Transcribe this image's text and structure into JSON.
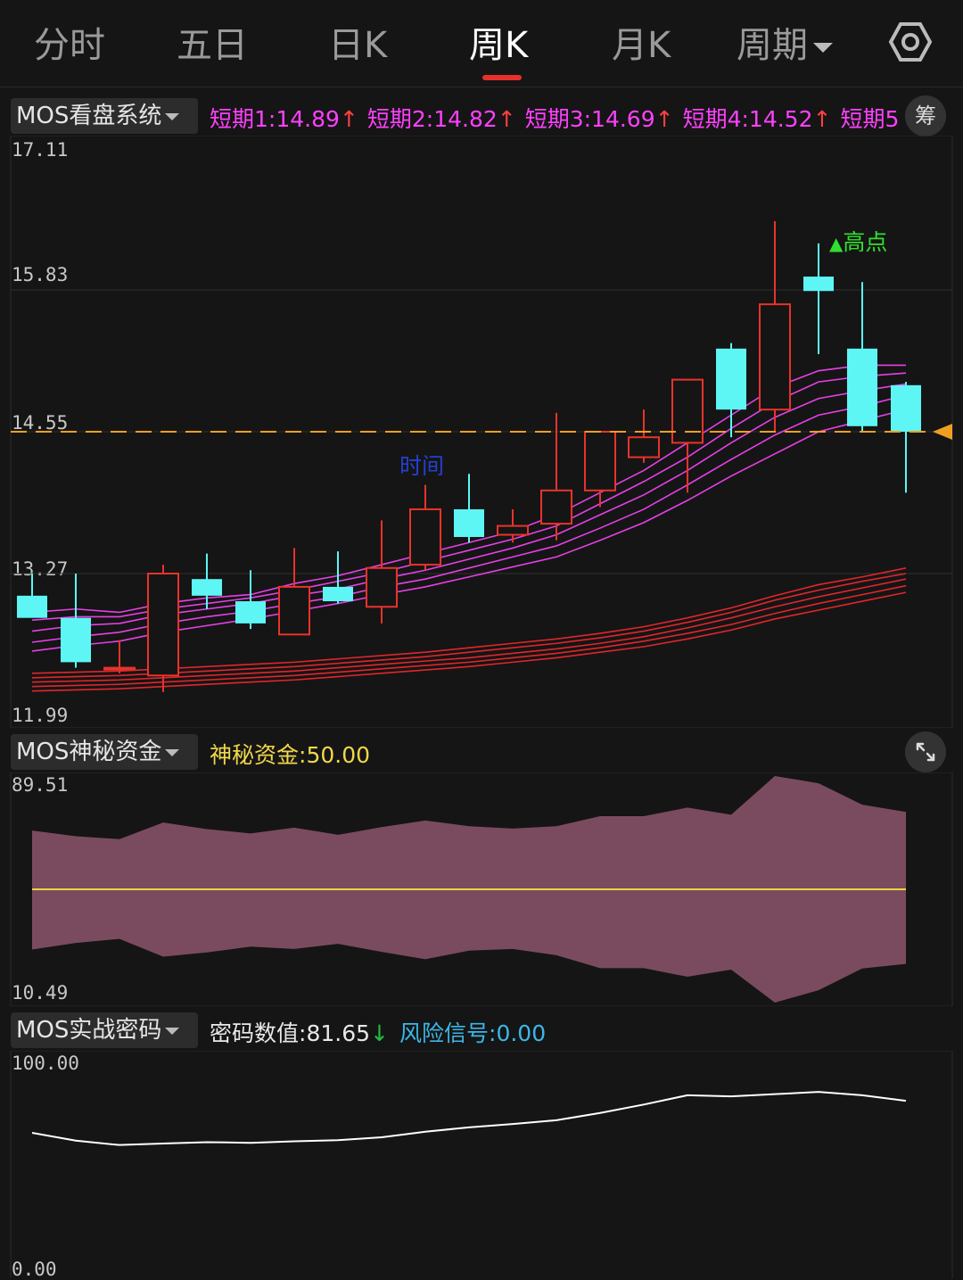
{
  "tabs": [
    {
      "label": "分时"
    },
    {
      "label": "五日"
    },
    {
      "label": "日K"
    },
    {
      "label": "周K",
      "active": true
    },
    {
      "label": "月K"
    },
    {
      "label": "周期"
    }
  ],
  "icons": {
    "settings": "gear-hexagon-icon",
    "expand": "expand-arrows-icon",
    "chips": "筹"
  },
  "main_panel": {
    "selector": "MOS看盘系统",
    "legend": [
      {
        "name": "短期1",
        "value": "14.89",
        "arrow": "↑"
      },
      {
        "name": "短期2",
        "value": "14.82",
        "arrow": "↑"
      },
      {
        "name": "短期3",
        "value": "14.69",
        "arrow": "↑"
      },
      {
        "name": "短期4",
        "value": "14.52",
        "arrow": "↑"
      },
      {
        "name": "短期5",
        "value": "",
        "arrow": ""
      }
    ],
    "y_labels": [
      "17.11",
      "15.83",
      "14.55",
      "13.27",
      "11.99"
    ],
    "annotation_time": "时间",
    "annotation_high": "高点",
    "high_marker": "▲"
  },
  "mid_panel": {
    "selector": "MOS神秘资金",
    "legend_name": "神秘资金",
    "legend_value": "50.00",
    "y_labels": [
      "89.51",
      "10.49"
    ]
  },
  "bottom_panel": {
    "selector": "MOS实战密码",
    "legend1_name": "密码数值",
    "legend1_value": "81.65",
    "legend1_arrow": "↓",
    "legend2_name": "风险信号",
    "legend2_value": "0.00",
    "y_labels": [
      "100.00",
      "0.00"
    ]
  },
  "colors": {
    "up": "#e8332b",
    "down": "#5ef5f5",
    "ma_short": "#e640e6",
    "ma_long": "#e0262b",
    "price_line": "#f0a020",
    "band": "#7a4b5e",
    "mid_line": "#e8d63a",
    "code_line": "#ffffff",
    "legend_magenta": "#ff40ff",
    "legend_yellow": "#f0d84a",
    "legend_cyan": "#3ab8e8",
    "arrow_up": "#ff4040",
    "arrow_down": "#20c040",
    "high_green": "#30e030"
  },
  "chart_data": [
    {
      "type": "candlestick",
      "ylim": [
        11.99,
        17.11
      ],
      "current_price": 14.55,
      "candles": [
        {
          "o": 13.07,
          "h": 13.27,
          "l": 12.95,
          "c": 12.87,
          "dir": "down"
        },
        {
          "o": 12.87,
          "h": 13.27,
          "l": 12.42,
          "c": 12.47,
          "dir": "down"
        },
        {
          "o": 12.42,
          "h": 12.67,
          "l": 12.37,
          "c": 12.42,
          "dir": "up"
        },
        {
          "o": 12.35,
          "h": 13.35,
          "l": 12.2,
          "c": 13.27,
          "dir": "up"
        },
        {
          "o": 13.22,
          "h": 13.45,
          "l": 12.95,
          "c": 13.07,
          "dir": "down"
        },
        {
          "o": 13.02,
          "h": 13.3,
          "l": 12.77,
          "c": 12.82,
          "dir": "down"
        },
        {
          "o": 12.72,
          "h": 13.5,
          "l": 12.72,
          "c": 13.15,
          "dir": "up"
        },
        {
          "o": 13.15,
          "h": 13.47,
          "l": 13.0,
          "c": 13.02,
          "dir": "down"
        },
        {
          "o": 12.97,
          "h": 13.75,
          "l": 12.82,
          "c": 13.32,
          "dir": "up"
        },
        {
          "o": 13.35,
          "h": 14.07,
          "l": 13.3,
          "c": 13.85,
          "dir": "up"
        },
        {
          "o": 13.85,
          "h": 14.17,
          "l": 13.55,
          "c": 13.6,
          "dir": "down"
        },
        {
          "o": 13.62,
          "h": 13.85,
          "l": 13.55,
          "c": 13.7,
          "dir": "up"
        },
        {
          "o": 13.72,
          "h": 14.72,
          "l": 13.57,
          "c": 14.02,
          "dir": "up"
        },
        {
          "o": 14.02,
          "h": 14.45,
          "l": 13.87,
          "c": 14.55,
          "dir": "up"
        },
        {
          "o": 14.32,
          "h": 14.75,
          "l": 14.27,
          "c": 14.5,
          "dir": "up"
        },
        {
          "o": 14.45,
          "h": 14.9,
          "l": 14.0,
          "c": 15.02,
          "dir": "up"
        },
        {
          "o": 14.75,
          "h": 15.35,
          "l": 14.5,
          "c": 15.3,
          "dir": "down"
        },
        {
          "o": 14.75,
          "h": 16.45,
          "l": 14.55,
          "c": 15.7,
          "dir": "up"
        },
        {
          "o": 15.95,
          "h": 16.25,
          "l": 15.25,
          "c": 15.82,
          "dir": "down"
        },
        {
          "o": 15.3,
          "h": 15.9,
          "l": 14.55,
          "c": 14.6,
          "dir": "down"
        },
        {
          "o": 14.97,
          "h": 15.0,
          "l": 14.0,
          "c": 14.55,
          "dir": "down"
        }
      ],
      "ma_short": [
        [
          12.92,
          12.95,
          12.92,
          13.0,
          13.05,
          13.08,
          13.18,
          13.25,
          13.35,
          13.45,
          13.55,
          13.65,
          13.8,
          14.0,
          14.2,
          14.45,
          14.7,
          14.95,
          15.1,
          15.15,
          15.15
        ],
        [
          12.85,
          12.88,
          12.88,
          12.95,
          13.0,
          13.05,
          13.12,
          13.2,
          13.28,
          13.38,
          13.48,
          13.58,
          13.7,
          13.9,
          14.1,
          14.32,
          14.58,
          14.82,
          15.0,
          15.05,
          15.08
        ],
        [
          12.75,
          12.8,
          12.82,
          12.9,
          12.95,
          13.0,
          13.07,
          13.13,
          13.22,
          13.3,
          13.4,
          13.5,
          13.62,
          13.8,
          13.98,
          14.2,
          14.45,
          14.68,
          14.85,
          14.92,
          14.98
        ],
        [
          12.65,
          12.7,
          12.74,
          12.82,
          12.88,
          12.93,
          13.0,
          13.06,
          13.15,
          13.22,
          13.32,
          13.42,
          13.52,
          13.68,
          13.85,
          14.07,
          14.3,
          14.52,
          14.7,
          14.78,
          14.88
        ],
        [
          12.57,
          12.62,
          12.66,
          12.74,
          12.8,
          12.86,
          12.93,
          13.0,
          13.08,
          13.15,
          13.24,
          13.33,
          13.42,
          13.57,
          13.73,
          13.93,
          14.15,
          14.35,
          14.55,
          14.65,
          14.75
        ]
      ],
      "ma_long": [
        [
          12.37,
          12.38,
          12.39,
          12.41,
          12.43,
          12.45,
          12.47,
          12.5,
          12.53,
          12.56,
          12.6,
          12.64,
          12.68,
          12.73,
          12.79,
          12.87,
          12.96,
          13.07,
          13.17,
          13.24,
          13.32
        ],
        [
          12.33,
          12.34,
          12.35,
          12.37,
          12.39,
          12.41,
          12.43,
          12.46,
          12.49,
          12.52,
          12.56,
          12.6,
          12.64,
          12.69,
          12.75,
          12.83,
          12.92,
          13.03,
          13.12,
          13.2,
          13.27
        ],
        [
          12.29,
          12.3,
          12.31,
          12.33,
          12.35,
          12.37,
          12.39,
          12.42,
          12.45,
          12.48,
          12.51,
          12.55,
          12.59,
          12.64,
          12.7,
          12.78,
          12.87,
          12.97,
          13.06,
          13.14,
          13.22
        ],
        [
          12.25,
          12.26,
          12.27,
          12.29,
          12.31,
          12.33,
          12.35,
          12.38,
          12.41,
          12.44,
          12.47,
          12.51,
          12.55,
          12.6,
          12.66,
          12.73,
          12.81,
          12.91,
          13.0,
          13.08,
          13.16
        ],
        [
          12.21,
          12.22,
          12.23,
          12.25,
          12.27,
          12.29,
          12.31,
          12.34,
          12.37,
          12.4,
          12.43,
          12.47,
          12.51,
          12.56,
          12.61,
          12.68,
          12.76,
          12.86,
          12.94,
          13.02,
          13.1
        ]
      ]
    },
    {
      "type": "area",
      "ylim": [
        10.49,
        89.51
      ],
      "mid": 50.0,
      "upper": [
        70.5,
        68.5,
        67.5,
        73.3,
        71.0,
        69.5,
        71.5,
        69.0,
        71.7,
        74.0,
        72.0,
        71.2,
        72.0,
        75.5,
        75.5,
        78.5,
        76.0,
        89.5,
        87.0,
        79.5,
        77.0
      ],
      "lower": [
        29.0,
        31.3,
        32.7,
        26.5,
        28.0,
        30.0,
        29.2,
        31.0,
        28.2,
        25.6,
        28.6,
        29.2,
        27.0,
        22.5,
        22.5,
        19.5,
        22.0,
        10.5,
        14.8,
        22.4,
        24.0
      ]
    },
    {
      "type": "line",
      "ylim": [
        0.0,
        100.0
      ],
      "values": [
        64.5,
        61.0,
        59.0,
        59.7,
        60.3,
        60.0,
        60.7,
        61.2,
        62.5,
        65.0,
        67.0,
        68.5,
        70.2,
        73.5,
        77.3,
        81.5,
        81.0,
        82.0,
        83.0,
        81.5,
        79.0
      ]
    }
  ]
}
